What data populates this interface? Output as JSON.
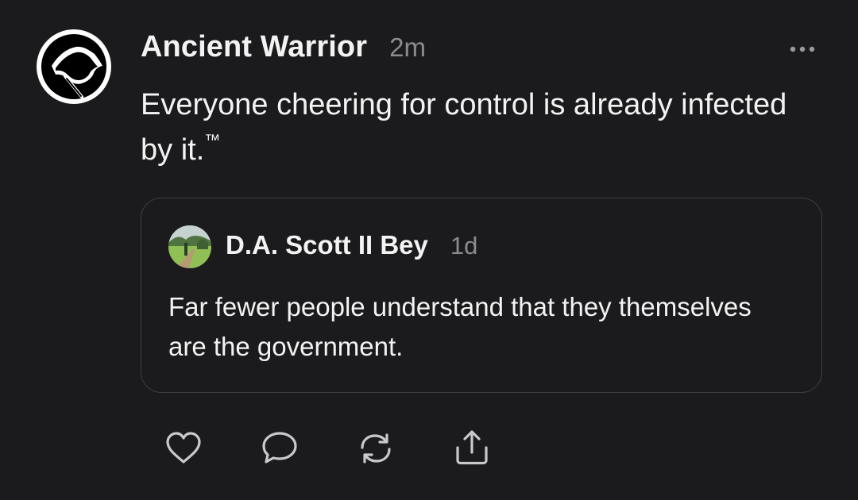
{
  "post": {
    "author": "Ancient Warrior",
    "timestamp": "2m",
    "text": "Everyone cheering for control is already infected by it.",
    "trademark": "™",
    "avatar_icon": "black-flag-icon",
    "more_icon": "more-horizontal-icon"
  },
  "quoted_post": {
    "author": "D.A. Scott II Bey",
    "timestamp": "1d",
    "text": "Far fewer people understand that they themselves are the government.",
    "avatar_icon": "landscape-photo-avatar"
  },
  "actions": [
    {
      "name": "like",
      "icon": "heart-icon"
    },
    {
      "name": "reply",
      "icon": "comment-icon"
    },
    {
      "name": "repost",
      "icon": "repost-icon"
    },
    {
      "name": "share",
      "icon": "share-icon"
    }
  ],
  "colors": {
    "background": "#1b1b1d",
    "text_primary": "#f3f3f3",
    "text_secondary": "#8c8c8f",
    "border": "#3e3e42",
    "icon": "#c9c9cc"
  }
}
